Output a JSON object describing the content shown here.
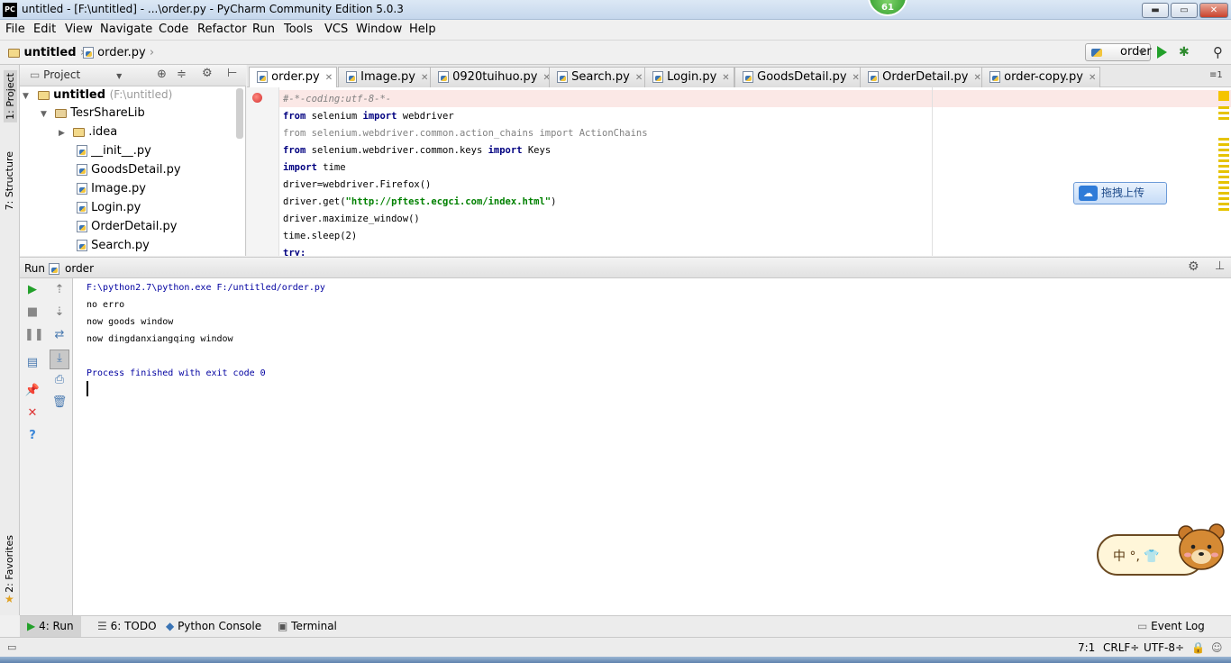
{
  "window": {
    "app_logo": "PC",
    "title": "untitled - [F:\\untitled] - ...\\order.py - PyCharm Community Edition 5.0.3",
    "notification_count": "61",
    "controls": {
      "minimize": "▬",
      "maximize": "▭",
      "close": "✕"
    }
  },
  "menu": [
    "File",
    "Edit",
    "View",
    "Navigate",
    "Code",
    "Refactor",
    "Run",
    "Tools",
    "VCS",
    "Window",
    "Help"
  ],
  "nav": {
    "project": "untitled",
    "file": "order.py",
    "run_config": "order"
  },
  "left_strip": {
    "project_tab": "1: Project",
    "structure_tab": "7: Structure",
    "favorites_tab": "2: Favorites"
  },
  "project_panel": {
    "title": "Project",
    "tree": [
      {
        "label": "untitled",
        "suffix": "(F:\\untitled)",
        "kind": "folder",
        "level": 0,
        "bold": true
      },
      {
        "label": "TesrShareLib",
        "kind": "package",
        "level": 1
      },
      {
        "label": ".idea",
        "kind": "folder",
        "level": 2
      },
      {
        "label": "__init__.py",
        "kind": "py",
        "level": 2
      },
      {
        "label": "GoodsDetail.py",
        "kind": "py",
        "level": 2
      },
      {
        "label": "Image.py",
        "kind": "py",
        "level": 2
      },
      {
        "label": "Login.py",
        "kind": "py",
        "level": 2
      },
      {
        "label": "OrderDetail.py",
        "kind": "py",
        "level": 2
      },
      {
        "label": "Search.py",
        "kind": "py",
        "level": 2
      }
    ]
  },
  "editor_tabs": [
    {
      "label": "order.py",
      "active": true
    },
    {
      "label": "Image.py"
    },
    {
      "label": "0920tuihuo.py"
    },
    {
      "label": "Search.py"
    },
    {
      "label": "Login.py"
    },
    {
      "label": "GoodsDetail.py"
    },
    {
      "label": "OrderDetail.py"
    },
    {
      "label": "order-copy.py"
    }
  ],
  "tabs_overflow": "≡1",
  "code": [
    "#-*-coding:utf-8-*-",
    "from selenium import webdriver",
    "from selenium.webdriver.common.action_chains import ActionChains",
    "from selenium.webdriver.common.keys import Keys",
    "import time",
    "driver=webdriver.Firefox()",
    "driver.get(\"http://pftest.ecgci.com/index.html\")",
    "driver.maximize_window()",
    "time.sleep(2)",
    "try:"
  ],
  "upload_button": "拖拽上传",
  "run_panel": {
    "label": "Run",
    "config": "order",
    "output": [
      "F:\\python2.7\\python.exe F:/untitled/order.py",
      "no erro",
      "now goods window",
      "now dingdanxiangqing window",
      "",
      "Process finished with exit code 0"
    ]
  },
  "bottom_tabs": [
    "4: Run",
    "6: TODO",
    "Python Console",
    "Terminal"
  ],
  "event_log": "Event Log",
  "status": {
    "position": "7:1",
    "line_sep": "CRLF÷",
    "encoding": "UTF-8÷"
  },
  "ime": "中 °, 👕"
}
